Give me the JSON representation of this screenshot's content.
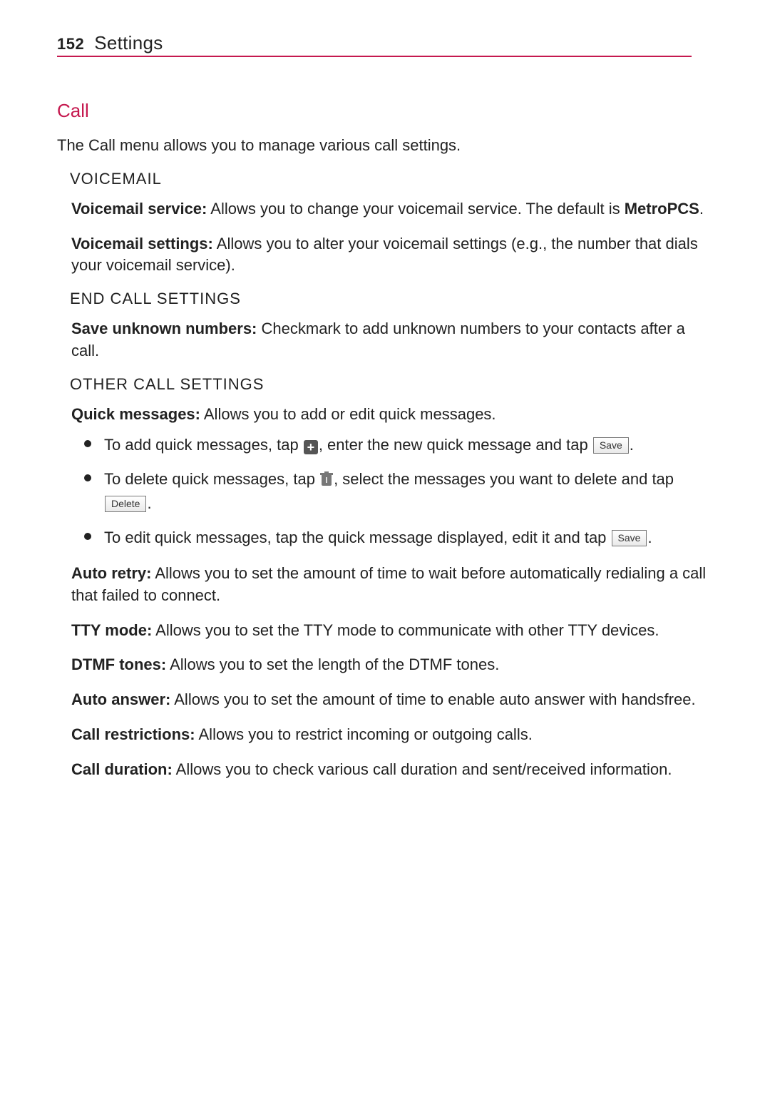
{
  "header": {
    "page_number": "152",
    "title": "Settings"
  },
  "section": {
    "title": "Call",
    "intro": "The Call menu allows you to manage various call settings."
  },
  "voicemail": {
    "heading": "VOICEMAIL",
    "service_label": "Voicemail service:",
    "service_text_a": " Allows you to change your voicemail service. The default is ",
    "service_default": "MetroPCS",
    "service_text_b": ".",
    "settings_label": "Voicemail settings:",
    "settings_text": " Allows you to alter your voicemail settings (e.g., the number that dials your voicemail service)."
  },
  "endcall": {
    "heading": "END CALL SETTINGS",
    "save_label": "Save unknown numbers:",
    "save_text": " Checkmark to add unknown numbers to your contacts after a call."
  },
  "other": {
    "heading": "OTHER CALL SETTINGS",
    "quick_label": "Quick messages:",
    "quick_text": " Allows you to add or edit quick messages.",
    "bullet1_a": "To add quick messages, tap ",
    "bullet1_b": ", enter the new quick message and tap ",
    "bullet1_c": ".",
    "bullet2_a": "To delete quick messages, tap ",
    "bullet2_b": ", select the messages you want to delete and tap ",
    "bullet2_c": ".",
    "bullet3_a": "To edit quick messages, tap the quick message displayed, edit it and tap ",
    "bullet3_b": ".",
    "save_btn": "Save",
    "delete_btn": "Delete",
    "auto_retry_label": "Auto retry:",
    "auto_retry_text": " Allows you to set the amount of time to wait before automatically redialing a call that failed to connect.",
    "tty_label": "TTY mode:",
    "tty_text": " Allows you to set the TTY mode to communicate with other TTY devices.",
    "dtmf_label": "DTMF tones:",
    "dtmf_text": " Allows you to set the length of the DTMF tones.",
    "auto_answer_label": "Auto answer:",
    "auto_answer_text": " Allows you to set the amount of time to enable auto answer with handsfree.",
    "restrict_label": "Call restrictions:",
    "restrict_text": " Allows you to restrict incoming or outgoing calls.",
    "duration_label": "Call duration:",
    "duration_text": " Allows you to check various call duration and sent/received information."
  }
}
